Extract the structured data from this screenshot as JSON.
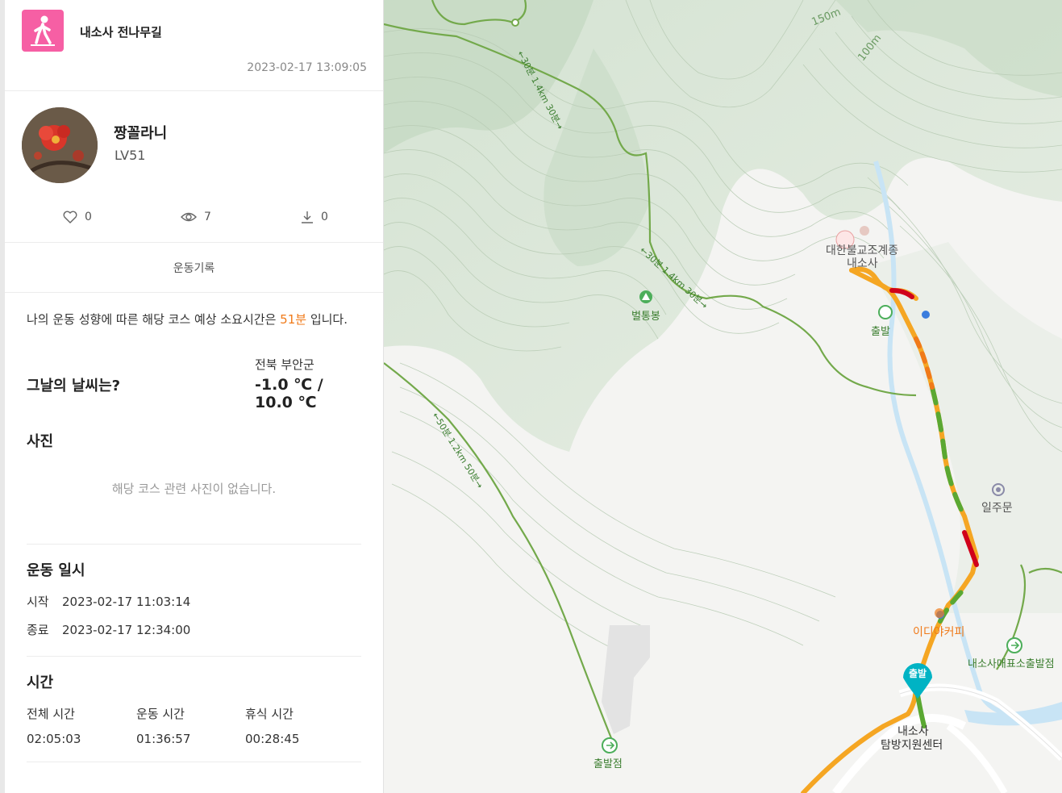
{
  "course": {
    "title": "내소사 전나무길",
    "datetime": "2023-02-17 13:09:05",
    "icon": "hiking-person-icon",
    "icon_color": "#f65fa4"
  },
  "user": {
    "name": "짱꼴라니",
    "level": "LV51"
  },
  "stats": {
    "likes": "0",
    "views": "7",
    "downloads": "0"
  },
  "tab": {
    "label": "운동기록"
  },
  "prediction": {
    "prefix": "나의 운동 성향에 따른 해당 코스 예상 소요시간은 ",
    "value": "51분",
    "suffix": " 입니다."
  },
  "weather": {
    "question": "그날의 날씨는?",
    "location": "전북 부안군",
    "temp": "-1.0 ℃ / 10.0 ℃"
  },
  "photos": {
    "heading": "사진",
    "empty": "해당 코스 관련 사진이 없습니다."
  },
  "exercise": {
    "heading": "운동 일시",
    "start_label": "시작",
    "start_value": "2023-02-17 11:03:14",
    "end_label": "종료",
    "end_value": "2023-02-17 12:34:00"
  },
  "time": {
    "heading": "시간",
    "total_label": "전체 시간",
    "total_value": "02:05:03",
    "moving_label": "운동 시간",
    "moving_value": "01:36:57",
    "rest_label": "휴식 시간",
    "rest_value": "00:28:45"
  },
  "map": {
    "labels": {
      "peak": "벌통봉",
      "temple": "내소사",
      "temple_full": "대한불교조계종",
      "start_top": "출발",
      "ilju": "일주문",
      "cafe": "이디야커피",
      "store": "내소사매표소출발점",
      "center1": "내소사",
      "center2": "탐방지원센터",
      "start_bottom": "출발점",
      "start_pin": "출발",
      "trail1": "←30분 1.4km 30분→",
      "trail2": "←30분 1.4km 30분→",
      "trail3": "←50분 1.2km 50분→",
      "contour1": "150m",
      "contour2": "100m"
    },
    "colors": {
      "trail": "#73a94b",
      "track_orange": "#f5a623",
      "track_green": "#5aa832",
      "track_red": "#d0021b",
      "pin": "#00b3c4",
      "water": "#c8e4f5"
    }
  }
}
